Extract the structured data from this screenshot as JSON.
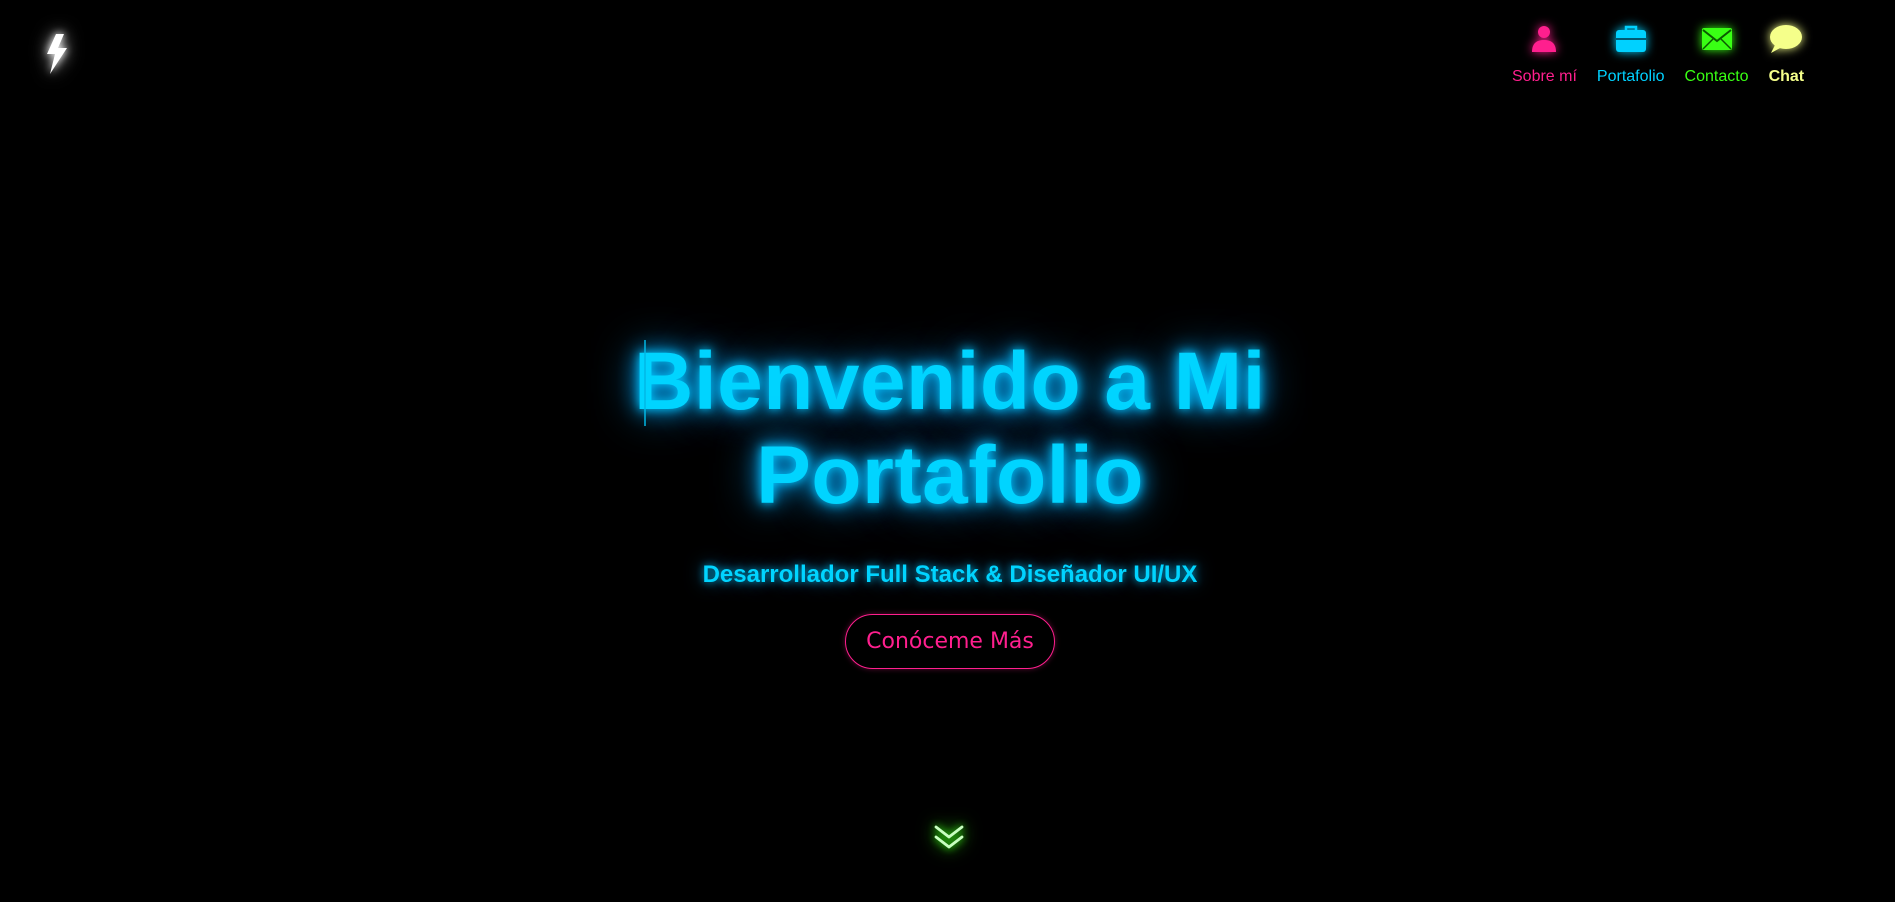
{
  "logo": {
    "icon": "lightning-bolt-icon",
    "color": "#ffffff"
  },
  "nav": {
    "items": [
      {
        "label": "Sobre mí",
        "icon": "user-icon",
        "color": "#ff1f8e"
      },
      {
        "label": "Portafolio",
        "icon": "briefcase-icon",
        "color": "#00d1ff"
      },
      {
        "label": "Contacto",
        "icon": "envelope-icon",
        "color": "#39ff14"
      },
      {
        "label": "Chat",
        "icon": "chat-bubble-icon",
        "color": "#f5ff8a"
      }
    ]
  },
  "hero": {
    "title_line1": "Bienvenido a Mi",
    "title_line2": "Portafolio",
    "subtitle": "Desarrollador Full Stack & Diseñador UI/UX",
    "cta_label": "Conóceme Más",
    "title_color": "#00d4ff",
    "cta_color": "#ff1f8e"
  },
  "scroll": {
    "icon": "chevrons-down-icon",
    "color": "#39ff14"
  }
}
